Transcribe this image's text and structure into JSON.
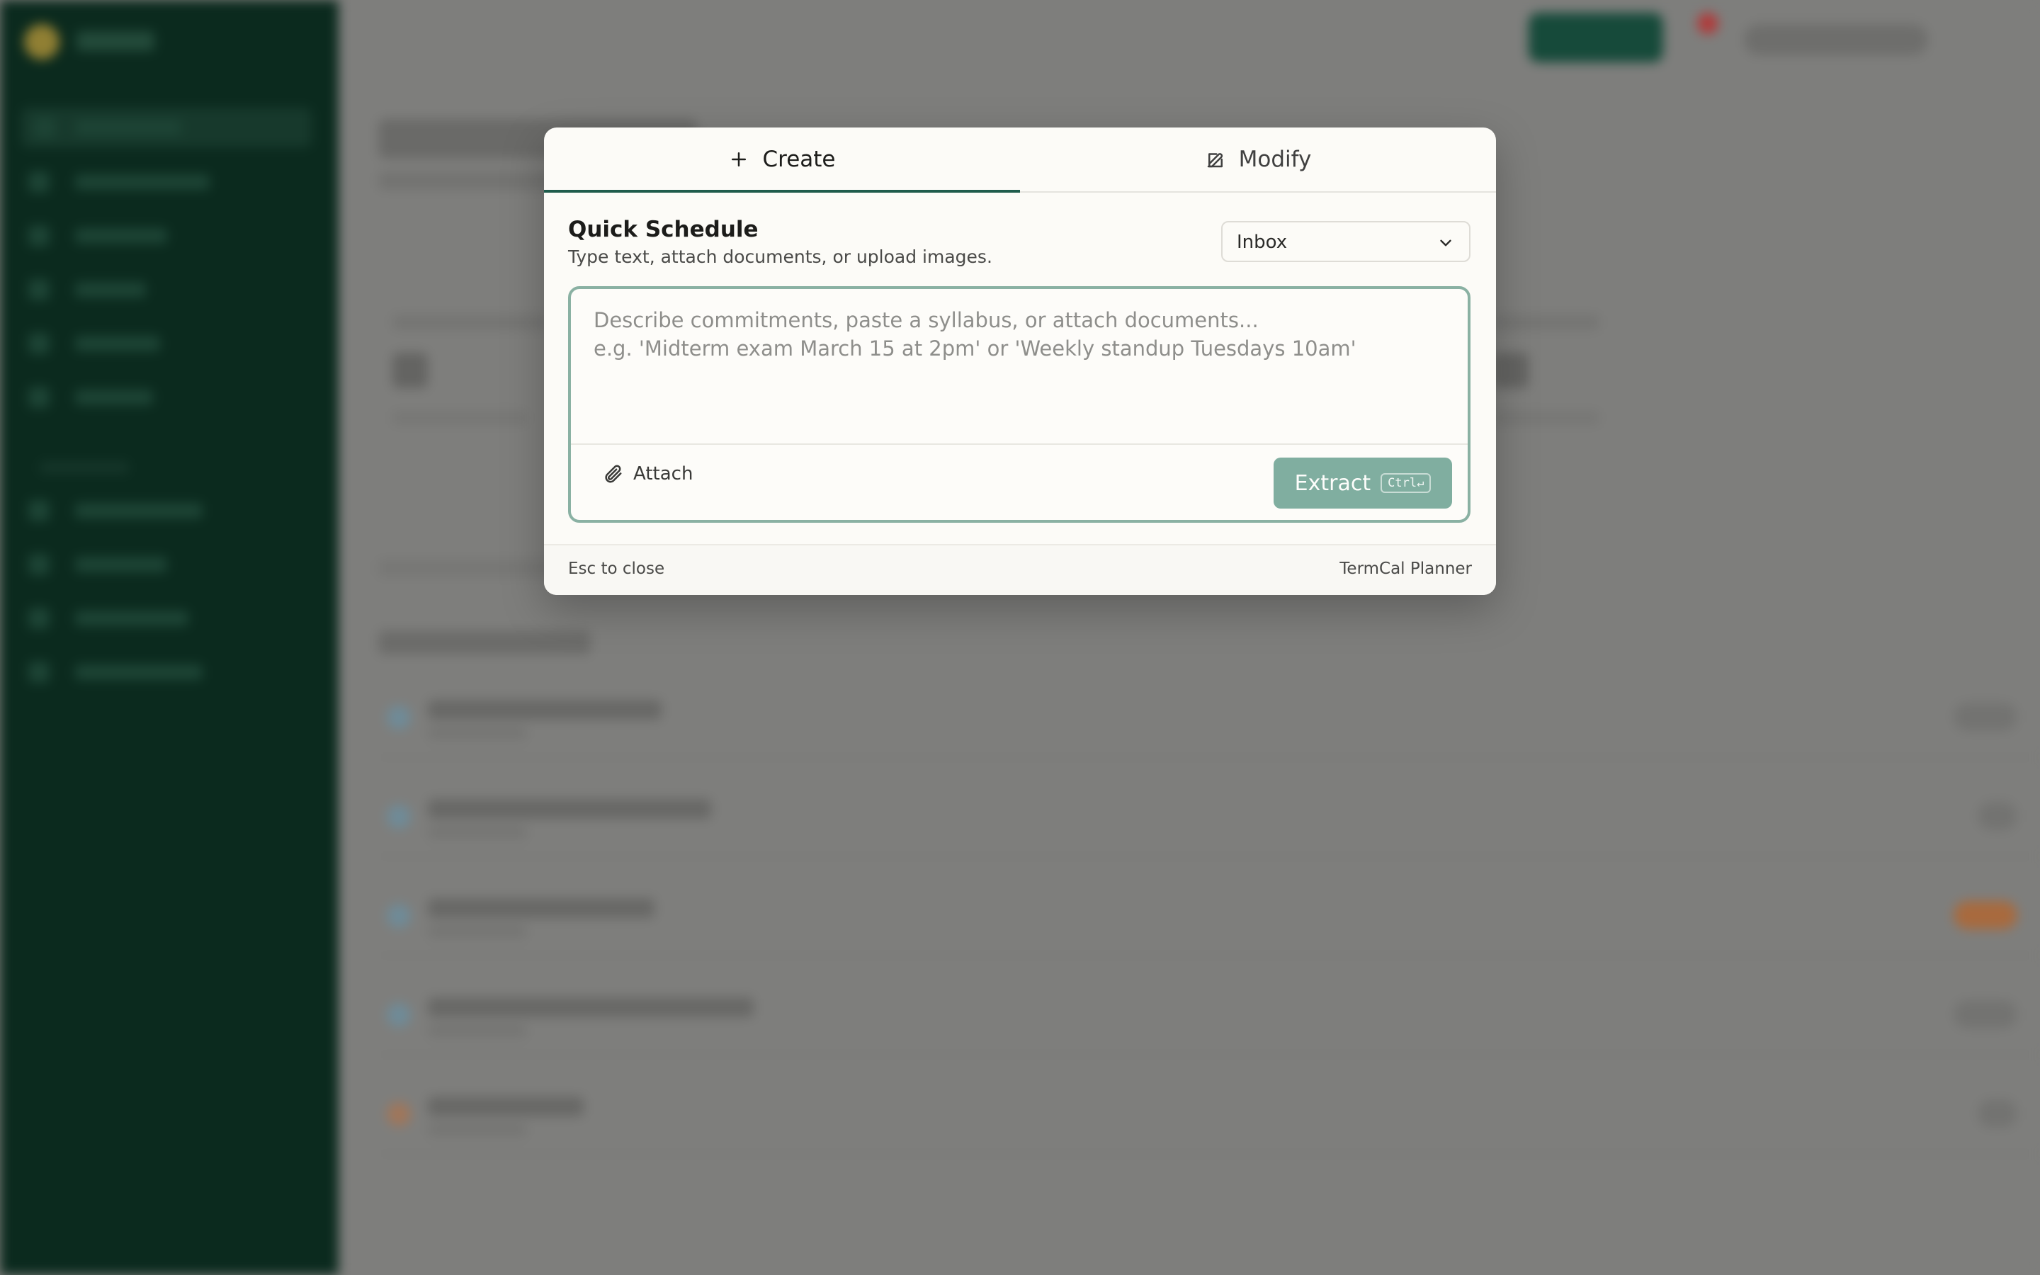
{
  "modal": {
    "tabs": [
      {
        "label": "Create",
        "icon": "plus-icon",
        "active": true
      },
      {
        "label": "Modify",
        "icon": "edit-icon",
        "active": false
      }
    ],
    "title": "Quick Schedule",
    "subtitle": "Type text, attach documents, or upload images.",
    "destination_select": {
      "value": "Inbox"
    },
    "input": {
      "placeholder": "Describe commitments, paste a syllabus, or attach documents...\ne.g. 'Midterm exam March 15 at 2pm' or 'Weekly standup Tuesdays 10am'"
    },
    "attach_label": "Attach",
    "extract_label": "Extract",
    "extract_shortcut": "Ctrl↵",
    "footer": {
      "hint": "Esc to close",
      "brand": "TermCal Planner"
    }
  },
  "colors": {
    "accent": "#1f5c4c",
    "extract_button": "#80aea0",
    "sidebar": "#0b2a1e"
  }
}
